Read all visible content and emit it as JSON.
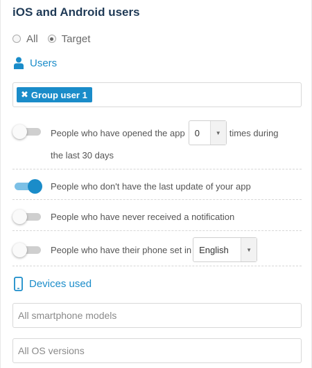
{
  "title": "iOS and Android users",
  "radio": {
    "all_label": "All",
    "target_label": "Target",
    "selected": "Target"
  },
  "users_section": {
    "label": "Users",
    "icon": "user-icon"
  },
  "tags": [
    {
      "label": "Group user 1",
      "remove_icon": "close-icon"
    }
  ],
  "rules": {
    "opened_app": {
      "enabled": false,
      "before": "People who have opened the app",
      "count_value": "0",
      "after": "times during",
      "line2": "the last 30 days"
    },
    "no_update": {
      "enabled": true,
      "label": "People who don't have the last update of your app"
    },
    "never_notified": {
      "enabled": false,
      "label": "People who have never received a notification"
    },
    "phone_language": {
      "enabled": false,
      "label": "People who have their phone set in",
      "language_value": "English"
    }
  },
  "devices_section": {
    "label": "Devices used",
    "icon": "smartphone-icon"
  },
  "fields": {
    "models_placeholder": "All smartphone models",
    "os_placeholder": "All OS versions"
  },
  "colors": {
    "accent": "#1a8cc9",
    "title": "#1f3a56"
  }
}
